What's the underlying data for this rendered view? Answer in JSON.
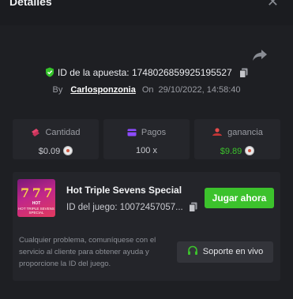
{
  "header": {
    "title": "Detalles"
  },
  "bet": {
    "id_label": "ID de la apuesta:",
    "id_value": "1748026859925195527",
    "by_label": "By",
    "user": "Carlosponzonia",
    "on_label": "On",
    "datetime": "29/10/2022, 14:58:40"
  },
  "stats": [
    {
      "label": "Cantidad",
      "value": "$0.09",
      "icon": "coins-icon",
      "color": "#e4456d"
    },
    {
      "label": "Pagos",
      "value": "100 x",
      "icon": "wallet-icon",
      "color": "#8d4bff"
    },
    {
      "label": "ganancia",
      "value": "$9.89",
      "icon": "profit-icon",
      "color": "#e54a4a"
    }
  ],
  "game": {
    "thumb_title": "7 7 7",
    "thumb_hot": "HOT",
    "thumb_sub": "HOT TRIPLE SEVENS SPECIAL",
    "name": "Hot Triple Sevens Special",
    "id_text": "ID del juego: 10072457057...",
    "play_label": "Jugar ahora",
    "help_text": "Cualquier problema, comuníquese con el servicio al cliente para obtener ayuda y proporcione la ID del juego.",
    "support_label": "Soporte en vivo"
  },
  "colors": {
    "accent": "#3cc22c",
    "profit": "#3cc22c",
    "bg": "#1e1f23"
  }
}
